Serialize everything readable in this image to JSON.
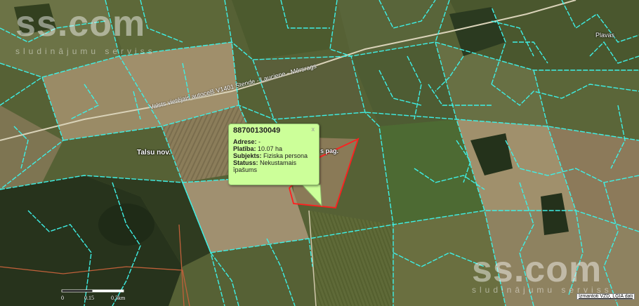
{
  "map": {
    "place_labels": [
      {
        "id": "talsu",
        "text": "Talsu nov."
      },
      {
        "id": "plavas",
        "text": "Plavas"
      }
    ],
    "road_label": "Valsts vietējais autoceļš V1401 Stende - Lauciene - Mērsrags",
    "parish_fragment": "s pag.",
    "watermark": {
      "main": "ss.com",
      "sub": "sludinājumu serviss"
    },
    "scale": {
      "labels": [
        "0",
        "0.15",
        "0.3km"
      ]
    },
    "credit": "Izmantoti VZD, LĢIA dati",
    "colors": {
      "parcel": "#3ef0e6",
      "selected": "#ff1f1f",
      "popup_bg": "#ccff99",
      "admin_border": "#c0603a"
    }
  },
  "popup": {
    "title": "88700130049",
    "close_label": "x",
    "rows": [
      {
        "label": "Adrese:",
        "value": " -"
      },
      {
        "label": "Platība:",
        "value": " 10.07 ha"
      },
      {
        "label": "Subjekts:",
        "value": " Fiziska persona"
      },
      {
        "label": "Statuss:",
        "value": " Nekustamais īpašums"
      }
    ]
  }
}
